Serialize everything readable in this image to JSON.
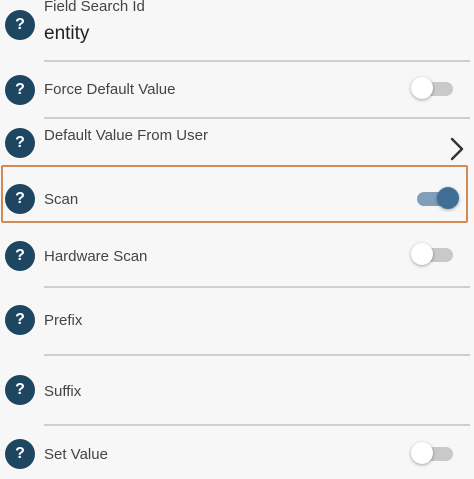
{
  "help_glyph": "?",
  "fields": {
    "field_search_id": {
      "label": "Field Search Id",
      "value": "entity"
    },
    "force_default_value": {
      "label": "Force Default Value",
      "toggle_on": false
    },
    "default_value_from_user": {
      "label": "Default Value From User",
      "icon": "chevron-right-icon"
    },
    "scan": {
      "label": "Scan",
      "toggle_on": true,
      "highlighted": true
    },
    "hardware_scan": {
      "label": "Hardware Scan",
      "toggle_on": false
    },
    "prefix": {
      "label": "Prefix"
    },
    "suffix": {
      "label": "Suffix"
    },
    "set_value": {
      "label": "Set Value",
      "toggle_on": false
    }
  },
  "colors": {
    "help_icon_bg": "#1f4661",
    "toggle_on_track": "#7f9fba",
    "toggle_on_knob": "#3f6f95",
    "highlight_border": "#d28a54",
    "background": "#f7f7f7"
  }
}
